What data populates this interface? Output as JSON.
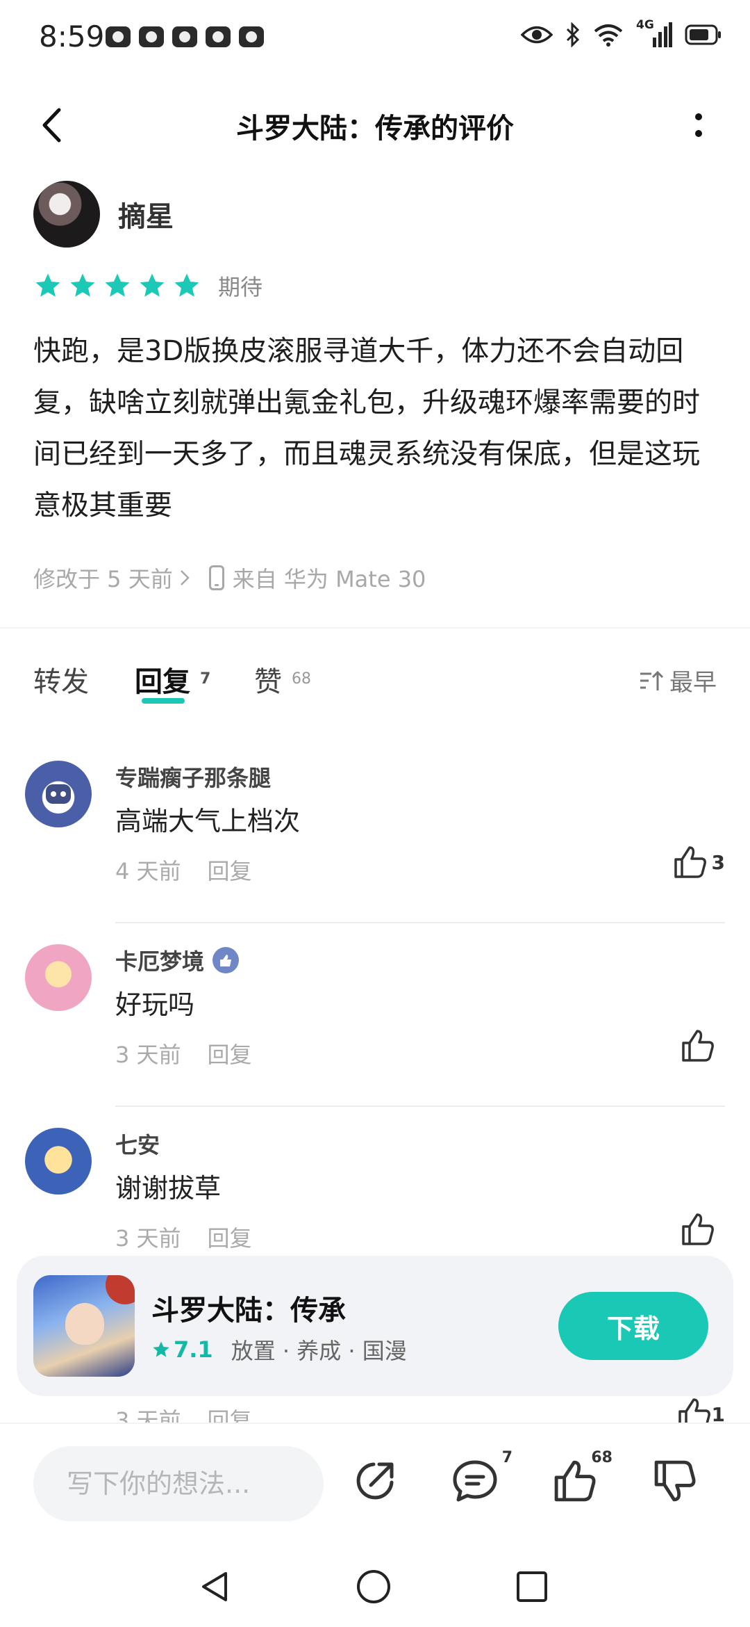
{
  "status_bar": {
    "time": "8:59",
    "network": "4G"
  },
  "header": {
    "title": "斗罗大陆：传承的评价"
  },
  "review": {
    "author": "摘星",
    "rating_stars": 5,
    "rating_label": "期待",
    "body": "快跑，是3D版换皮滚服寻道大千，体力还不会自动回复，缺啥立刻就弹出氪金礼包，升级魂环爆率需要的时间已经到一天多了，而且魂灵系统没有保底，但是这玩意极其重要",
    "edited": "修改于 5 天前",
    "device": "来自 华为 Mate 30"
  },
  "tabs": [
    {
      "label": "转发",
      "count": ""
    },
    {
      "label": "回复",
      "count": "7"
    },
    {
      "label": "赞",
      "count": "68"
    }
  ],
  "sort_label": "最早",
  "comments": [
    {
      "name": "专踹瘸子那条腿",
      "text": "高端大气上档次",
      "time": "4 天前",
      "reply": "回复",
      "likes": "3"
    },
    {
      "name": "卡厄梦境",
      "text": "好玩吗",
      "time": "3 天前",
      "reply": "回复",
      "likes": ""
    },
    {
      "name": "七安",
      "text": "谢谢拔草",
      "time": "3 天前",
      "reply": "回复",
      "likes": ""
    }
  ],
  "peek_comment": {
    "time": "3 天前",
    "reply": "回复",
    "likes": "1"
  },
  "app_card": {
    "name": "斗罗大陆：传承",
    "score": "7.1",
    "tags": "放置 · 养成 · 国漫",
    "download_label": "下载"
  },
  "bottom_bar": {
    "input_placeholder": "写下你的想法...",
    "comment_count": "7",
    "like_count": "68"
  },
  "colors": {
    "accent": "#19c9b5",
    "star": "#1cc9b6"
  }
}
